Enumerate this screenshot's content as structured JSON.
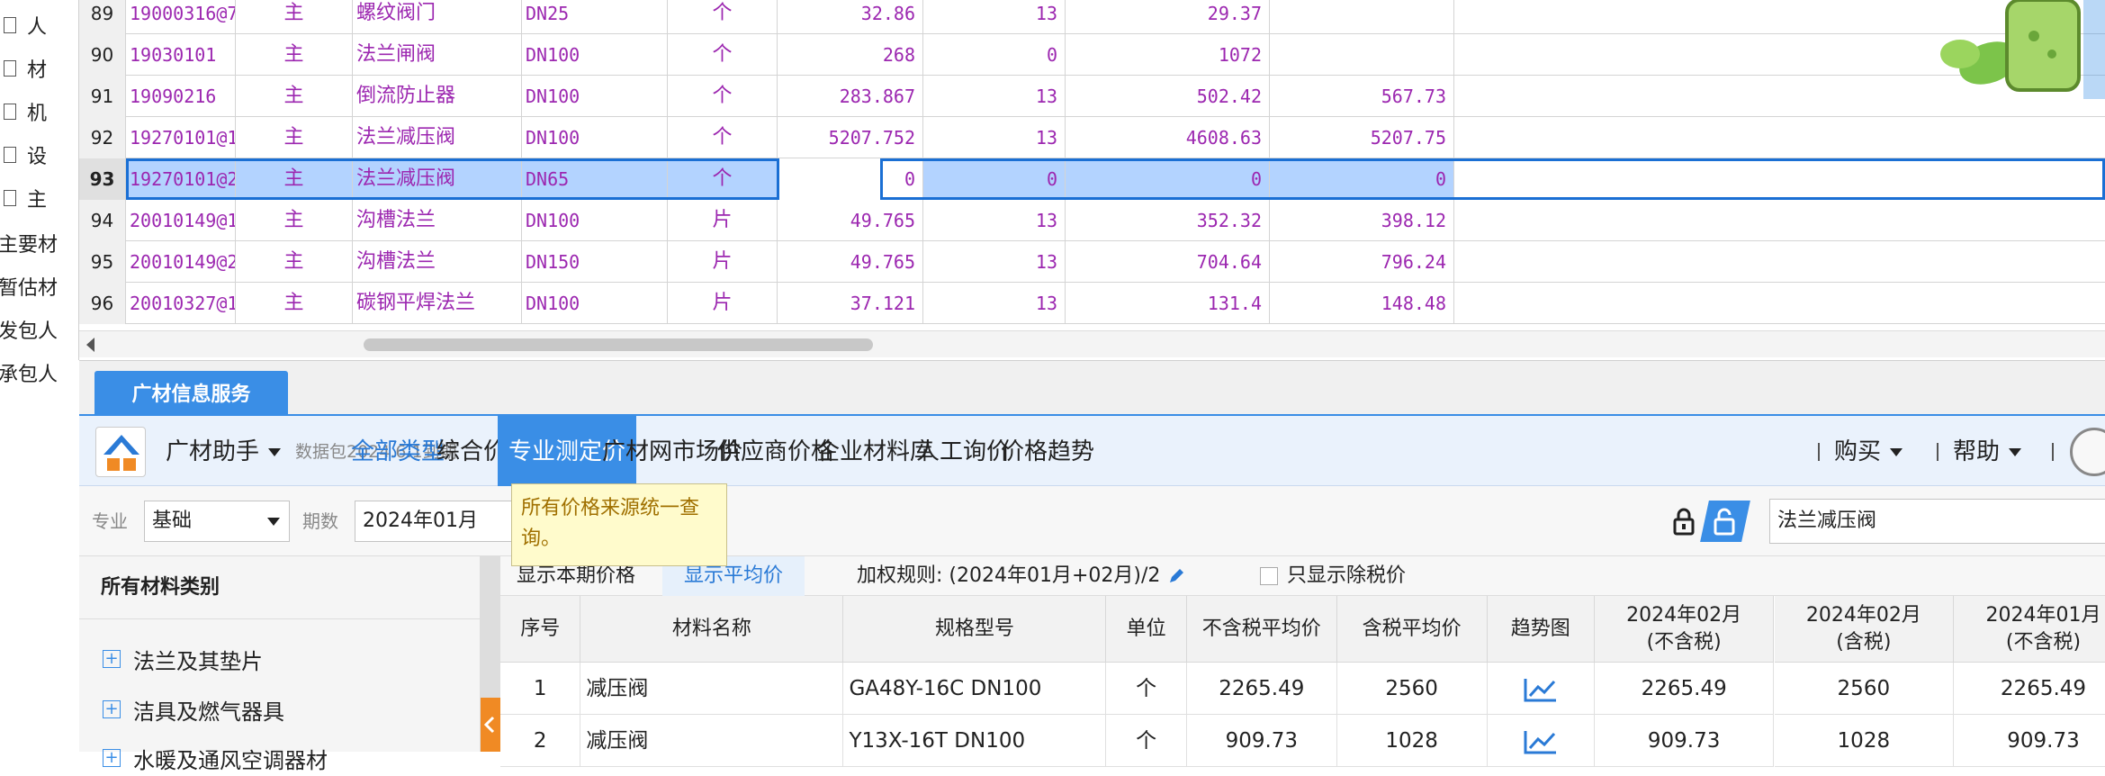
{
  "left_nav": {
    "items": [
      "人",
      "材",
      "机",
      "设",
      "主",
      "主要材",
      "暂估材",
      "发包人",
      "承包人"
    ]
  },
  "grid": {
    "rows": [
      {
        "no": "89",
        "code": "19000316@7",
        "type": "主",
        "name": "螺纹阀门",
        "spec": "DN25",
        "unit": "个",
        "price": "32.86",
        "rate": "13",
        "c1": "29.37",
        "c2": ""
      },
      {
        "no": "90",
        "code": "19030101",
        "type": "主",
        "name": "法兰闸阀",
        "spec": "DN100",
        "unit": "个",
        "price": "268",
        "rate": "0",
        "c1": "1072",
        "c2": ""
      },
      {
        "no": "91",
        "code": "19090216",
        "type": "主",
        "name": "倒流防止器",
        "spec": "DN100",
        "unit": "个",
        "price": "283.867",
        "rate": "13",
        "c1": "502.42",
        "c2": "567.73"
      },
      {
        "no": "92",
        "code": "19270101@1",
        "type": "主",
        "name": "法兰减压阀",
        "spec": "DN100",
        "unit": "个",
        "price": "5207.752",
        "rate": "13",
        "c1": "4608.63",
        "c2": "5207.75"
      },
      {
        "no": "93",
        "code": "19270101@2",
        "type": "主",
        "name": "法兰减压阀",
        "spec": "DN65",
        "unit": "个",
        "price": "0",
        "rate": "0",
        "c1": "0",
        "c2": "0"
      },
      {
        "no": "94",
        "code": "20010149@1",
        "type": "主",
        "name": "沟槽法兰",
        "spec": "DN100",
        "unit": "片",
        "price": "49.765",
        "rate": "13",
        "c1": "352.32",
        "c2": "398.12"
      },
      {
        "no": "95",
        "code": "20010149@2",
        "type": "主",
        "name": "沟槽法兰",
        "spec": "DN150",
        "unit": "片",
        "price": "49.765",
        "rate": "13",
        "c1": "704.64",
        "c2": "796.24"
      },
      {
        "no": "96",
        "code": "20010327@1",
        "type": "主",
        "name": "碳钢平焊法兰",
        "spec": "DN100",
        "unit": "片",
        "price": "37.121",
        "rate": "13",
        "c1": "131.4",
        "c2": "148.48"
      }
    ]
  },
  "panel_tab": "广材信息服务",
  "toolbar": {
    "assistant": "广材助手",
    "data_pkg": "数据包2024.6.1到期",
    "tabs": [
      "全部类型",
      "综合价",
      "专业测定价",
      "广材网市场价",
      "供应商价格",
      "企业材料库",
      "人工询价",
      "价格趋势"
    ],
    "buy": "购买",
    "help": "帮助"
  },
  "filters": {
    "major_label": "专业",
    "major_value": "基础",
    "period_label": "期数",
    "period_value": "2024年01月",
    "tooltip": "所有价格来源统一查询。",
    "search_value": "法兰减压阀"
  },
  "categories": {
    "header": "所有材料类别",
    "items": [
      "法兰及其垫片",
      "洁具及燃气器具",
      "水暖及通风空调器材"
    ]
  },
  "price_tabs": {
    "current": "显示本期价格",
    "average": "显示平均价",
    "rule": "加权规则: (2024年01月+02月)/2",
    "tax_only": "只显示除税价"
  },
  "result_table": {
    "headers": [
      "序号",
      "材料名称",
      "规格型号",
      "单位",
      "不含税平均价",
      "含税平均价",
      "趋势图",
      "2024年02月\n(不含税)",
      "2024年02月\n(含税)",
      "2024年01月\n(不含税)"
    ],
    "rows": [
      {
        "no": "1",
        "name": "减压阀",
        "spec": "GA48Y-16C DN100",
        "unit": "个",
        "avg_ex": "2265.49",
        "avg_in": "2560",
        "feb_ex": "2265.49",
        "feb_in": "2560",
        "jan_ex": "2265.49"
      },
      {
        "no": "2",
        "name": "减压阀",
        "spec": "Y13X-16T DN100",
        "unit": "个",
        "avg_ex": "909.73",
        "avg_in": "1028",
        "feb_ex": "909.73",
        "feb_in": "1028",
        "jan_ex": "909.73"
      }
    ]
  },
  "colors": {
    "accent": "#3a8ee6",
    "grid_text": "#9c27b0",
    "selection": "#b3d3ff",
    "tooltip_bg": "#fffbcc",
    "orange": "#f08a24"
  }
}
